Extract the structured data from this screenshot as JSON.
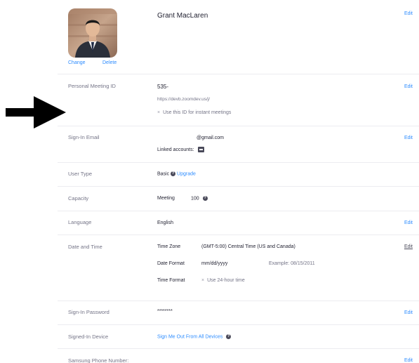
{
  "profile": {
    "name": "Grant MacLaren",
    "change_label": "Change",
    "delete_label": "Delete",
    "edit_label": "Edit"
  },
  "pmi": {
    "label": "Personal Meeting ID",
    "id_value": "535-",
    "url": "https://devb.zoomdev.us/j/",
    "instant_option": "Use this ID for instant meetings",
    "edit_label": "Edit"
  },
  "email": {
    "label": "Sign-In Email",
    "value": "@gmail.com",
    "linked_label": "Linked accounts:",
    "edit_label": "Edit"
  },
  "user_type": {
    "label": "User Type",
    "value": "Basic",
    "upgrade_label": "Upgrade"
  },
  "capacity": {
    "label": "Capacity",
    "meeting_label": "Meeting",
    "meeting_value": "100"
  },
  "language": {
    "label": "Language",
    "value": "English",
    "edit_label": "Edit"
  },
  "datetime": {
    "label": "Date and Time",
    "timezone_label": "Time Zone",
    "timezone_value": "(GMT-5:00) Central Time (US and Canada)",
    "date_format_label": "Date Format",
    "date_format_value": "mm/dd/yyyy",
    "example": "Example: 08/15/2011",
    "time_format_label": "Time Format",
    "time_format_option": "Use 24-hour time",
    "edit_label": "Edit"
  },
  "password": {
    "label": "Sign-In Password",
    "value": "********",
    "edit_label": "Edit"
  },
  "device": {
    "label": "Signed-In Device",
    "action_label": "Sign Me Out From All Devices"
  },
  "phone": {
    "label": "Samsung Phone Number:",
    "edit_label": "Edit"
  },
  "icons": {
    "help": "question-circle-icon",
    "linked": "linked-account-icon",
    "arrow": "arrow-right-icon",
    "x": "x-mark-icon"
  },
  "colors": {
    "link": "#2d8cff",
    "text": "#232333",
    "muted": "#747487",
    "divider": "#ececf0"
  }
}
